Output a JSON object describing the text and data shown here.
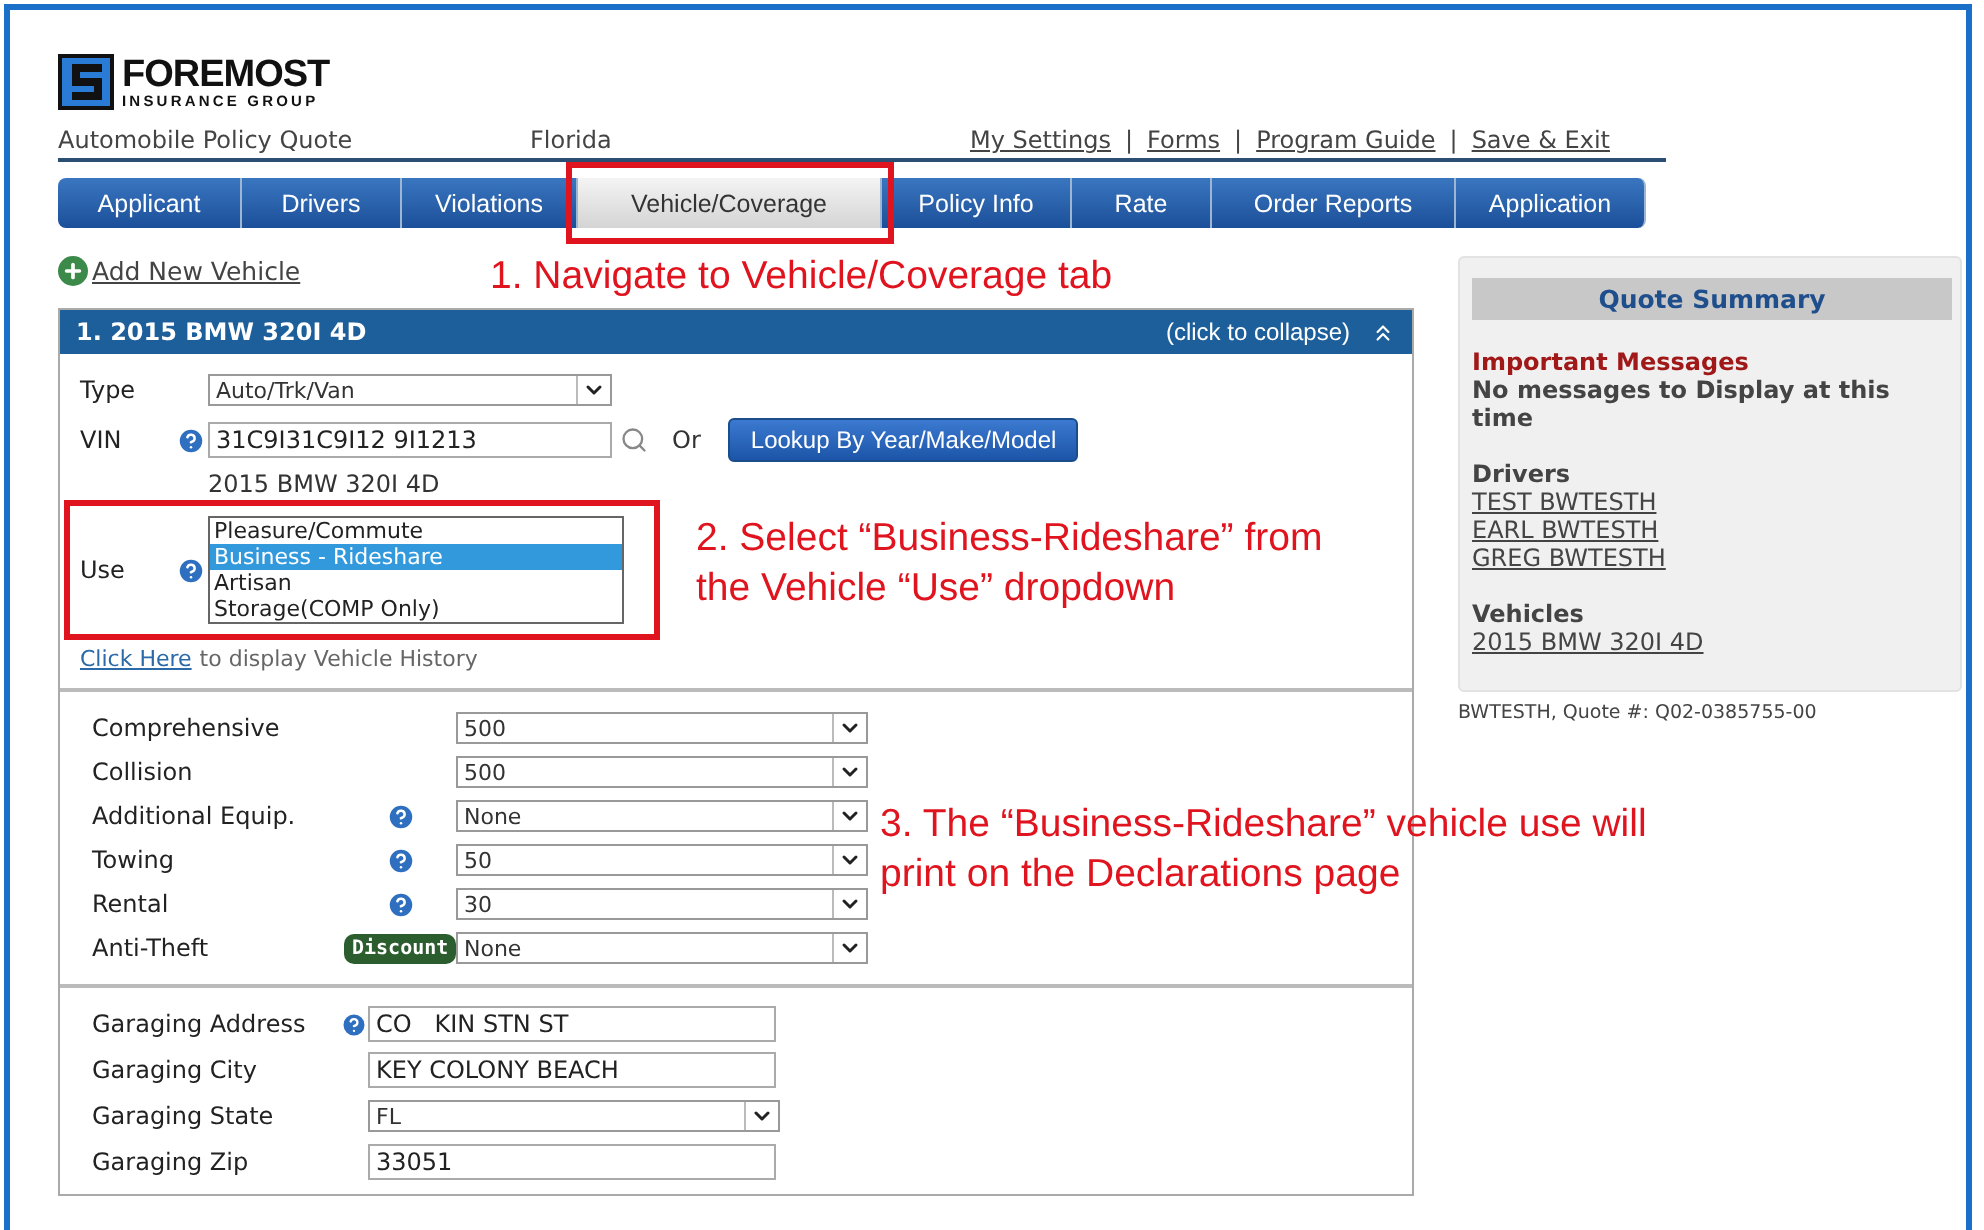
{
  "logo": {
    "name": "FOREMOST",
    "tagline": "INSURANCE GROUP"
  },
  "header": {
    "title": "Automobile Policy Quote",
    "state": "Florida",
    "separator": "|",
    "links": [
      "My Settings",
      "Forms",
      "Program Guide",
      "Save & Exit"
    ]
  },
  "tabs": [
    {
      "label": "Applicant",
      "selected": false,
      "highlighted": false
    },
    {
      "label": "Drivers",
      "selected": false,
      "highlighted": false
    },
    {
      "label": "Violations",
      "selected": false,
      "highlighted": false
    },
    {
      "label": "Vehicle/Coverage",
      "selected": true,
      "highlighted": true
    },
    {
      "label": "Policy Info",
      "selected": false,
      "highlighted": false
    },
    {
      "label": "Rate",
      "selected": false,
      "highlighted": false
    },
    {
      "label": "Order Reports",
      "selected": false,
      "highlighted": false
    },
    {
      "label": "Application",
      "selected": false,
      "highlighted": false
    }
  ],
  "add_vehicle": "Add New Vehicle",
  "vehicle": {
    "title": "1. 2015 BMW 320I 4D",
    "toggle": "(click to collapse)",
    "expanded": true,
    "type_label": "Type",
    "type_value": "Auto/Trk/Van",
    "vin_label": "VIN",
    "vin_value": "31C9I31C9I12 9I1213",
    "or": "Or",
    "lookup_button": "Lookup By Year/Make/Model",
    "description": "2015 BMW 320I 4D",
    "use_label": "Use",
    "use_highlighted": true,
    "use_options": [
      {
        "label": "Pleasure/Commute",
        "selected": false
      },
      {
        "label": "Business - Rideshare",
        "selected": true
      },
      {
        "label": "Artisan",
        "selected": false
      },
      {
        "label": "Storage(COMP Only)",
        "selected": false
      }
    ],
    "history_link": "Click Here",
    "history_text": "to display Vehicle History"
  },
  "coverages": [
    {
      "label": "Comprehensive",
      "help": false,
      "value": "500"
    },
    {
      "label": "Collision",
      "help": false,
      "value": "500"
    },
    {
      "label": "Additional Equip.",
      "help": true,
      "value": "None"
    },
    {
      "label": "Towing",
      "help": true,
      "value": "50"
    },
    {
      "label": "Rental",
      "help": true,
      "value": "30"
    },
    {
      "label": "Anti-Theft",
      "help": false,
      "badge": "Discount",
      "value": "None"
    }
  ],
  "garaging": [
    {
      "label": "Garaging Address",
      "help": true,
      "kind": "input",
      "value": "CO   KIN STN ST"
    },
    {
      "label": "Garaging City",
      "help": false,
      "kind": "input",
      "value": "KEY COLONY BEACH"
    },
    {
      "label": "Garaging State",
      "help": false,
      "kind": "select",
      "value": "FL"
    },
    {
      "label": "Garaging Zip",
      "help": false,
      "kind": "input",
      "value": "33051"
    }
  ],
  "summary": {
    "title": "Quote Summary",
    "messages_heading": "Important Messages",
    "message": "No messages to Display at this time",
    "drivers_heading": "Drivers",
    "drivers": [
      "TEST BWTESTH",
      "EARL BWTESTH",
      "GREG BWTESTH"
    ],
    "vehicles_heading": "Vehicles",
    "vehicles": [
      "2015 BMW 320I 4D"
    ],
    "quote_line": "BWTESTH, Quote #: Q02-0385755-00"
  },
  "annotations": [
    {
      "text": "1. Navigate to Vehicle/Coverage tab"
    },
    {
      "text": "2. Select “Business-Rideshare” from the Vehicle “Use” dropdown"
    },
    {
      "text": "3. The “Business-Rideshare” vehicle use will print on the Declarations page"
    }
  ]
}
